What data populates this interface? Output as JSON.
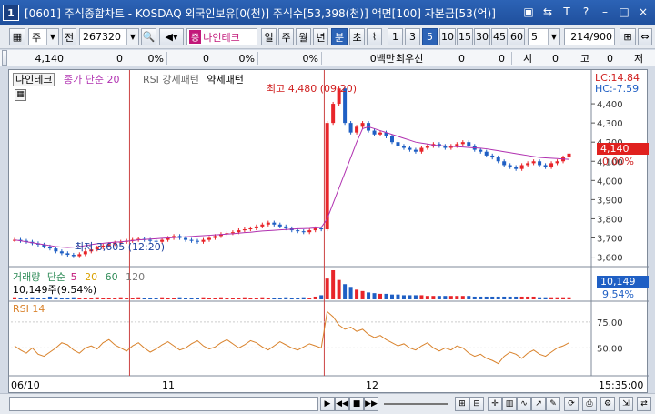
{
  "window": {
    "icon_label": "1",
    "title": "[0601] 주식종합차트 - KOSDAQ 외국인보유[0(천)] 주식수[53,398(천)] 액면[100] 자본금[53(억)]",
    "controls": [
      "▣",
      "⇆",
      "T",
      "?",
      "–",
      "□",
      "×"
    ]
  },
  "toolbar": {
    "type_select": "주",
    "prev_label": "전",
    "code": "267320",
    "stock_badge": "증",
    "stock_name": "나인테크",
    "periods": [
      "일",
      "주",
      "월",
      "년",
      "분",
      "초"
    ],
    "selected_period": "분",
    "intervals": [
      "1",
      "3",
      "5",
      "10",
      "15",
      "30",
      "45",
      "60"
    ],
    "selected_interval": "5",
    "count_value": "5",
    "page_value": "214",
    "page_total": "/900"
  },
  "values_bar": {
    "price": "4,140",
    "v1": "0",
    "v2": "0%",
    "v3": "0",
    "v4": "0%",
    "v5": "0%",
    "v6": "0백만",
    "v7": "최우선",
    "v8": "0",
    "v9": "0",
    "l1": "시",
    "v10": "0",
    "l2": "고",
    "v11": "0",
    "l3": "저"
  },
  "chart_legend": {
    "stock_name": "나인테크",
    "ma_label": "종가 단순 20",
    "rsi_pattern_label": "RSI 강세패턴",
    "weak_pattern_label": "약세패턴",
    "max_label": "최고 4,480 (09:20)",
    "min_label": "최저 3,605 (12:20)",
    "lc": "LC:14.84",
    "hc": "HC:-7.59",
    "price_tag": "4,140",
    "pct_tag": "0.00%"
  },
  "volume_panel": {
    "title": "거래량",
    "ma_label": "단순",
    "periods": [
      "5",
      "20",
      "60",
      "120"
    ],
    "value_text": "10,149주(9.54%)",
    "value_tag": "10,149",
    "pct_tag": "9.54%"
  },
  "rsi_panel": {
    "title": "RSI 14",
    "ticks": [
      "75.00",
      "50.00"
    ]
  },
  "x_axis": {
    "labels": [
      "06/10",
      "11",
      "12"
    ],
    "time_tag": "15:35:00"
  },
  "colors": {
    "up": "#e8252a",
    "down": "#1f5fc4",
    "ma20": "#b030b0",
    "rsi": "#d9822b",
    "separator": "#c44"
  },
  "chart_data": {
    "type": "candlestick",
    "price_ticks": [
      4400,
      4300,
      4200,
      4100,
      4000,
      3900,
      3800,
      3700,
      3600
    ],
    "ylim": [
      3560,
      4500
    ],
    "x_categories": [
      "06/10",
      "11",
      "12"
    ],
    "close_series": [
      3690,
      3685,
      3680,
      3672,
      3665,
      3655,
      3645,
      3630,
      3620,
      3612,
      3605,
      3615,
      3630,
      3640,
      3650,
      3660,
      3668,
      3675,
      3680,
      3685,
      3690,
      3695,
      3690,
      3685,
      3680,
      3690,
      3700,
      3710,
      3700,
      3690,
      3685,
      3680,
      3690,
      3700,
      3710,
      3720,
      3725,
      3730,
      3740,
      3745,
      3750,
      3760,
      3770,
      3780,
      3770,
      3760,
      3750,
      3740,
      3735,
      3730,
      3740,
      3750,
      3745,
      4300,
      4400,
      4480,
      4300,
      4250,
      4280,
      4300,
      4260,
      4240,
      4250,
      4230,
      4200,
      4180,
      4170,
      4160,
      4150,
      4170,
      4180,
      4190,
      4180,
      4170,
      4180,
      4190,
      4200,
      4180,
      4160,
      4150,
      4130,
      4120,
      4100,
      4080,
      4070,
      4060,
      4080,
      4090,
      4100,
      4080,
      4070,
      4090,
      4100,
      4120,
      4140
    ],
    "ma20_series": [
      3690,
      3685,
      3680,
      3675,
      3670,
      3665,
      3660,
      3655,
      3652,
      3650,
      3652,
      3655,
      3660,
      3665,
      3670,
      3672,
      3675,
      3678,
      3680,
      3683,
      3686,
      3690,
      3692,
      3694,
      3696,
      3698,
      3700,
      3702,
      3704,
      3706,
      3708,
      3710,
      3712,
      3714,
      3716,
      3718,
      3720,
      3722,
      3725,
      3728,
      3730,
      3733,
      3736,
      3738,
      3740,
      3742,
      3744,
      3746,
      3748,
      3749,
      3750,
      3752,
      3755,
      3800,
      3880,
      3960,
      4040,
      4120,
      4200,
      4270,
      4280,
      4270,
      4260,
      4250,
      4240,
      4230,
      4220,
      4210,
      4200,
      4195,
      4190,
      4185,
      4182,
      4180,
      4178,
      4176,
      4174,
      4172,
      4170,
      4168,
      4165,
      4160,
      4155,
      4150,
      4145,
      4140,
      4135,
      4130,
      4125,
      4120,
      4118,
      4116,
      4114,
      4112,
      4110
    ],
    "rsi_series": [
      52,
      48,
      45,
      50,
      44,
      42,
      46,
      50,
      55,
      53,
      48,
      45,
      50,
      52,
      49,
      55,
      58,
      53,
      50,
      47,
      52,
      55,
      50,
      46,
      49,
      53,
      56,
      52,
      48,
      50,
      54,
      57,
      52,
      49,
      51,
      55,
      58,
      54,
      50,
      53,
      57,
      55,
      51,
      48,
      52,
      56,
      53,
      50,
      48,
      51,
      54,
      52,
      50,
      85,
      80,
      72,
      68,
      70,
      66,
      68,
      63,
      60,
      62,
      58,
      55,
      52,
      54,
      50,
      48,
      52,
      55,
      50,
      47,
      50,
      48,
      52,
      50,
      45,
      42,
      44,
      40,
      38,
      35,
      42,
      46,
      44,
      40,
      45,
      48,
      44,
      42,
      46,
      50,
      52,
      55
    ],
    "volume_series": [
      3,
      2,
      2,
      3,
      2,
      2,
      4,
      3,
      2,
      2,
      3,
      2,
      2,
      2,
      3,
      2,
      2,
      2,
      3,
      2,
      2,
      3,
      2,
      2,
      2,
      3,
      2,
      2,
      3,
      2,
      2,
      2,
      3,
      2,
      2,
      3,
      2,
      2,
      2,
      3,
      2,
      2,
      3,
      2,
      2,
      2,
      3,
      2,
      2,
      3,
      2,
      4,
      6,
      30,
      42,
      28,
      22,
      18,
      14,
      12,
      10,
      9,
      8,
      8,
      7,
      7,
      6,
      6,
      6,
      6,
      5,
      5,
      5,
      5,
      5,
      5,
      5,
      5,
      4,
      4,
      4,
      4,
      4,
      4,
      4,
      4,
      4,
      4,
      4,
      3,
      3,
      3,
      3,
      3,
      3
    ],
    "rsi_ticks": [
      75,
      50
    ],
    "rsi_ylim": [
      25,
      95
    ]
  }
}
